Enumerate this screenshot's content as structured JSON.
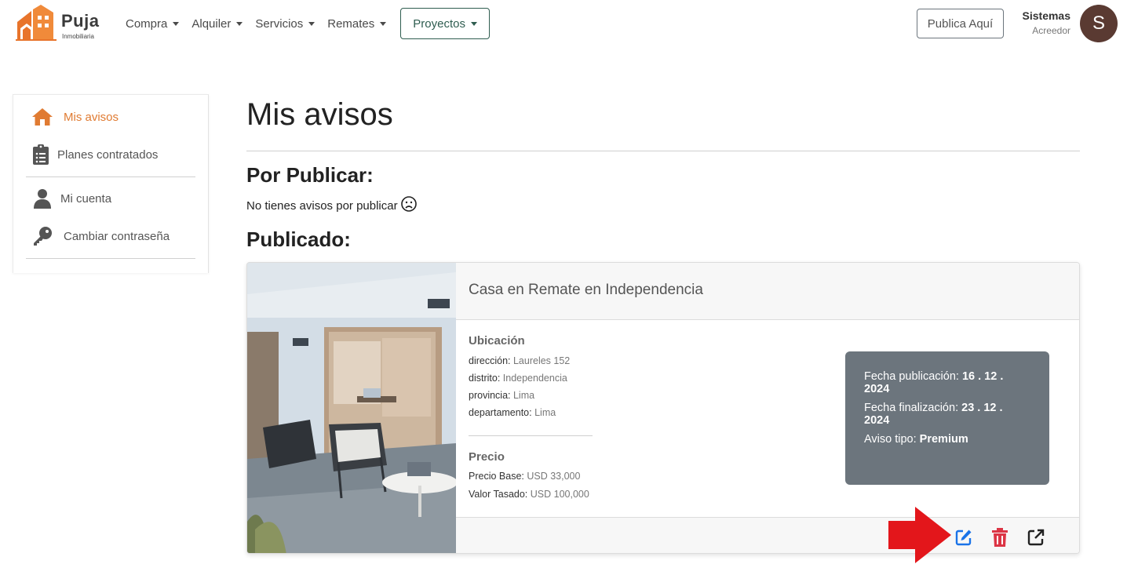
{
  "brand": {
    "name": "Puja",
    "subtitle": "Inmobiliaria",
    "color": "#e8742b"
  },
  "nav": {
    "items": [
      {
        "label": "Compra"
      },
      {
        "label": "Alquiler"
      },
      {
        "label": "Servicios"
      },
      {
        "label": "Remates"
      },
      {
        "label": "Proyectos"
      }
    ],
    "publish_label": "Publica Aquí"
  },
  "user": {
    "name": "Sistemas",
    "role": "Acreedor",
    "initial": "S",
    "avatar_color": "#5a3a32"
  },
  "sidebar": {
    "items": [
      {
        "label": "Mis avisos",
        "icon": "home-icon",
        "active": true
      },
      {
        "label": "Planes contratados",
        "icon": "clipboard-list-icon"
      },
      {
        "label": "Mi cuenta",
        "icon": "user-icon"
      },
      {
        "label": "Cambiar contraseña",
        "icon": "key-icon"
      }
    ],
    "active_color": "#e07b32"
  },
  "main": {
    "title": "Mis avisos",
    "pending": {
      "heading": "Por Publicar:",
      "empty_text": "No tienes avisos por publicar"
    },
    "published": {
      "heading": "Publicado:"
    }
  },
  "listing": {
    "title": "Casa en Remate en Independencia",
    "location": {
      "heading": "Ubicación",
      "fields": [
        {
          "key": "dirección:",
          "value": "Laureles 152"
        },
        {
          "key": "distrito:",
          "value": "Independencia"
        },
        {
          "key": "provincia:",
          "value": "Lima"
        },
        {
          "key": "departamento:",
          "value": "Lima"
        }
      ]
    },
    "price": {
      "heading": "Precio",
      "fields": [
        {
          "key": "Precio Base:",
          "value": "USD 33,000"
        },
        {
          "key": "Valor Tasado:",
          "value": "USD 100,000"
        }
      ]
    },
    "info": {
      "pub_label": "Fecha publicación:",
      "pub_value": "16 . 12 . 2024",
      "end_label": "Fecha finalización:",
      "end_value": "23 . 12 . 2024",
      "type_label": "Aviso tipo:",
      "type_value": "Premium",
      "bg": "#6c757d"
    },
    "actions": [
      {
        "icon": "edit-icon",
        "color": "#1a73e8"
      },
      {
        "icon": "trash-icon",
        "color": "#dc3545"
      },
      {
        "icon": "external-link-icon",
        "color": "#222222"
      }
    ]
  },
  "annotation": {
    "icon": "red-arrow-icon",
    "color": "#e3161b"
  }
}
